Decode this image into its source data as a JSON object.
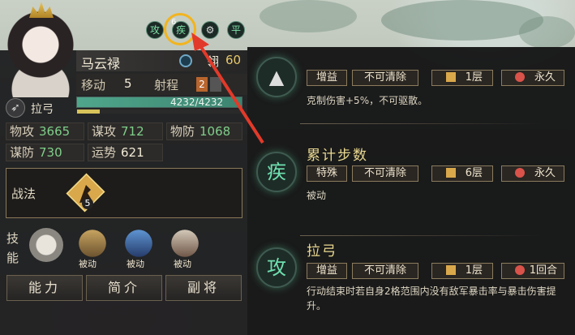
{
  "hero": {
    "name": "马云禄",
    "class_label": "翎",
    "class_value": "60",
    "move_label": "移动",
    "move_value": "5",
    "range_label": "射程",
    "range_value": "2",
    "hp_text": "4232/4232",
    "hp_fraction": 1.0,
    "mp_fraction": 0.14,
    "weapon": "拉弓"
  },
  "stats": [
    {
      "label": "物攻",
      "value": "3665"
    },
    {
      "label": "谋攻",
      "value": "712"
    },
    {
      "label": "物防",
      "value": "1068"
    },
    {
      "label": "谋防",
      "value": "730"
    },
    {
      "label": "运势",
      "value": "621"
    }
  ],
  "tactics": {
    "label": "战法",
    "level": "5"
  },
  "skills": {
    "label": "技能",
    "items": [
      {
        "icon": "archer-skill-icon",
        "tag": ""
      },
      {
        "icon": "bow-skill-icon",
        "tag": "被动"
      },
      {
        "icon": "blue-slash-skill-icon",
        "tag": "被动"
      },
      {
        "icon": "warrior-skill-icon",
        "tag": "被动"
      }
    ]
  },
  "buttons": [
    "能力",
    "简介",
    "副将"
  ],
  "buff_badges": [
    {
      "glyph": "攻",
      "icon": "attack-buff-icon"
    },
    {
      "glyph": "疾",
      "icon": "haste-buff-icon",
      "count": "6"
    },
    {
      "glyph": "",
      "icon": "gear-buff-icon"
    },
    {
      "glyph": "平",
      "icon": "calm-buff-icon"
    }
  ],
  "buff_entries": [
    {
      "title": "",
      "icon": "counter-buff-icon",
      "tags": [
        "增益",
        "不可清除",
        "1层",
        "永久"
      ],
      "desc": "克制伤害+5%，不可驱散。"
    },
    {
      "title": "累计步数",
      "glyph": "疾",
      "icon": "haste-buff-icon",
      "tags": [
        "特殊",
        "不可清除",
        "6层",
        "永久"
      ],
      "desc": "被动"
    },
    {
      "title": "拉弓",
      "glyph": "攻",
      "icon": "attack-buff-icon",
      "tags": [
        "增益",
        "不可清除",
        "1层",
        "1回合"
      ],
      "desc": "行动结束时若自身2格范围内没有敌军暴击率与暴击伤害提升。"
    }
  ],
  "colors": {
    "highlight": "#f2b41e",
    "arrow": "#e23a2a",
    "buff_green": "#6fe0b0",
    "title_gold": "#e9d890"
  }
}
